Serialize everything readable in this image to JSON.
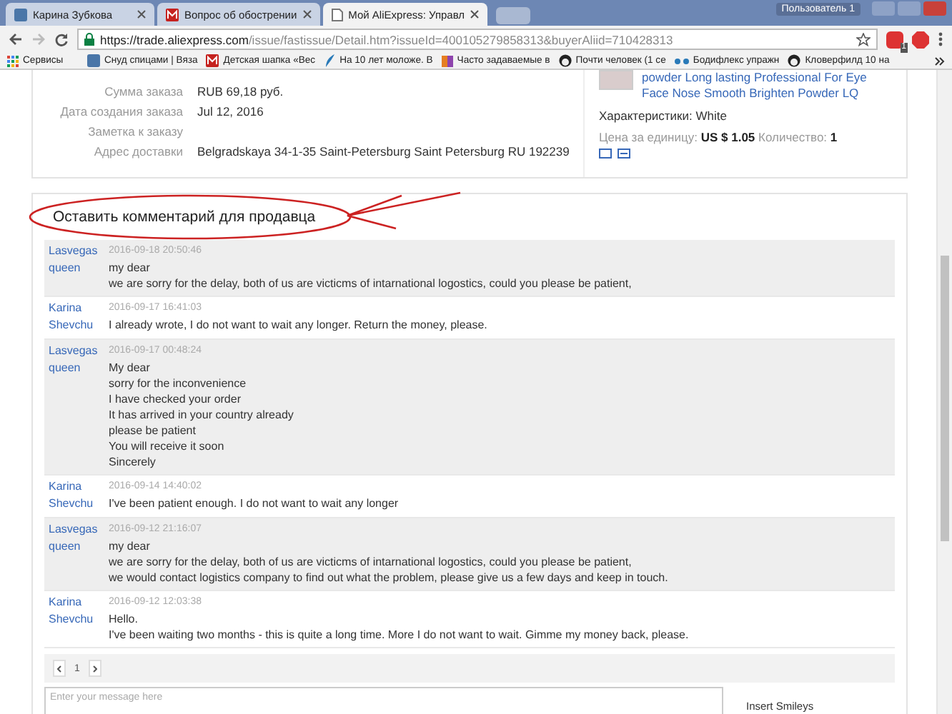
{
  "browser": {
    "tabs": [
      {
        "title": "Карина Зубкова",
        "selected": false
      },
      {
        "title": "Вопрос об обострении",
        "selected": false
      },
      {
        "title": "Мой AliExpress: Управл",
        "selected": true
      }
    ],
    "profile": "Пользователь 1",
    "url_host": "https://trade.aliexpress.com",
    "url_path": "/issue/fastissue/Detail.htm?issueId=400105279858313&buyerAliid=710428313",
    "extension_badge": "1",
    "bookmarks": [
      "Сервисы",
      "Снуд спицами | Вяза",
      "Детская шапка «Вес",
      "На 10 лет моложе. В",
      "Часто задаваемые в",
      "Почти человек (1 се",
      "Бодифлекс упражн",
      "Кловерфилд 10 на"
    ]
  },
  "order": {
    "fields": [
      {
        "label": "Сумма заказа",
        "value": "RUB 69,18 руб."
      },
      {
        "label": "Дата создания заказа",
        "value": "Jul 12, 2016"
      },
      {
        "label": "Заметка к заказу"
      },
      {
        "label": "Адрес доставки",
        "value": "Belgradskaya 34-1-35 Saint-Petersburg Saint Petersburg RU 192239"
      }
    ],
    "product_lines": [
      "powder Long lasting Professional For Eye",
      "Face Nose Smooth Brighten Powder LQ"
    ],
    "characteristics_label": "Характеристики:",
    "characteristics_value": "White",
    "price_label": "Цена за единицу:",
    "price_value": "US $ 1.05",
    "qty_label": "Количество:",
    "qty_value": "1"
  },
  "comments": {
    "title": "Оставить комментарий для продавца",
    "messages": [
      {
        "author": [
          "Lasvegas",
          "queen"
        ],
        "date": "2016-09-18 20:50:46",
        "shaded": true,
        "lines": [
          "my dear",
          "we are sorry for the delay, both of us are victicms of intarnational logostics, could you please be patient,"
        ]
      },
      {
        "author": [
          "Karina",
          "Shevchu"
        ],
        "date": "2016-09-17 16:41:03",
        "shaded": false,
        "lines": [
          "I already wrote, I do not want to wait any longer. Return the money, please."
        ]
      },
      {
        "author": [
          "Lasvegas",
          "queen"
        ],
        "date": "2016-09-17 00:48:24",
        "shaded": true,
        "lines": [
          "My dear",
          "sorry for the inconvenience",
          "I have checked your order",
          "It has arrived in your country already",
          "please be patient",
          "You will receive it soon",
          "Sincerely"
        ]
      },
      {
        "author": [
          "Karina",
          "Shevchu"
        ],
        "date": "2016-09-14 14:40:02",
        "shaded": false,
        "lines": [
          "I've been patient enough. I do not want to wait any longer"
        ]
      },
      {
        "author": [
          "Lasvegas",
          "queen"
        ],
        "date": "2016-09-12 21:16:07",
        "shaded": true,
        "lines": [
          "my dear",
          "we are sorry for the delay, both of us are victicms of intarnational logostics, could you please be patient,",
          "we would contact logistics company to find out what the problem, please give us a few days and keep in touch."
        ]
      },
      {
        "author": [
          "Karina",
          "Shevchu"
        ],
        "date": "2016-09-12 12:03:38",
        "shaded": false,
        "lines": [
          "Hello.",
          "I've been waiting two months - this is quite a long time. More I do not want to wait. Gimme my money back, please."
        ]
      }
    ],
    "page": "1",
    "placeholder": "Enter your message here",
    "smileys": "Insert Smileys"
  }
}
